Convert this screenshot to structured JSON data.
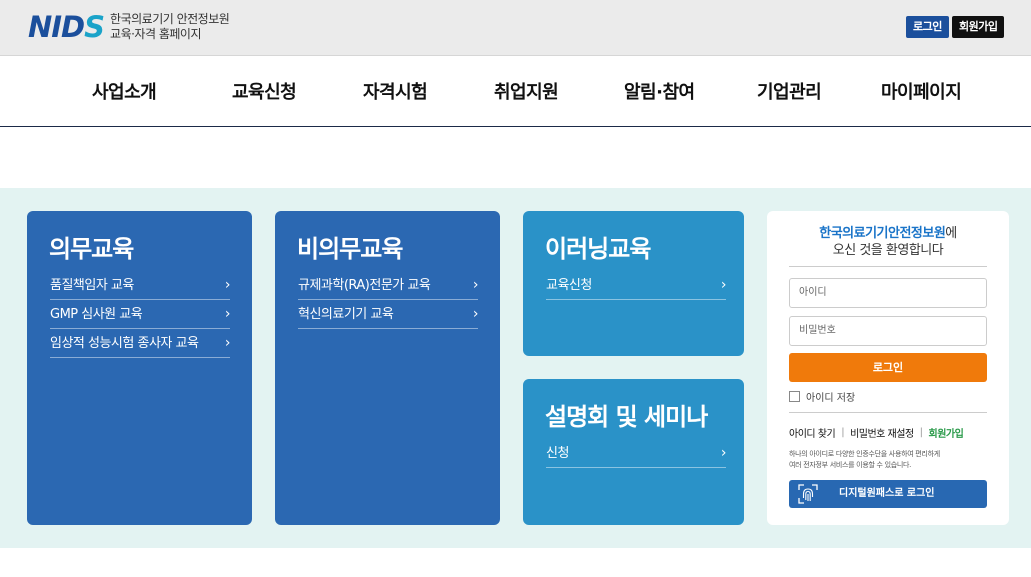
{
  "header": {
    "logo_mark_1": "NID",
    "logo_mark_2": "S",
    "logo_line1": "한국의료기기 안전정보원",
    "logo_line2": "교육·자격 홈페이지",
    "login": "로그인",
    "join": "회원가입"
  },
  "nav": [
    "사업소개",
    "교육신청",
    "자격시험",
    "취업지원",
    "알림·참여",
    "기업관리",
    "마이페이지"
  ],
  "cards": {
    "mandatory": {
      "title": "의무교육",
      "links": [
        "품질책임자 교육",
        "GMP 심사원 교육",
        "임상적 성능시험 종사자 교육"
      ]
    },
    "optional": {
      "title": "비의무교육",
      "links": [
        "규제과학(RA)전문가 교육",
        "혁신의료기기 교육"
      ]
    },
    "elearning": {
      "title": "이러닝교육",
      "links": [
        "교육신청"
      ]
    },
    "seminar": {
      "title": "설명회 및 세미나",
      "links": [
        "신청"
      ]
    },
    "chevron": "›"
  },
  "login_box": {
    "welcome_brand": "한국의료기기안전정보원",
    "welcome_suffix": "에",
    "welcome_line2": "오신 것을 환영합니다",
    "id_placeholder": "아이디",
    "pw_placeholder": "비밀번호",
    "login_button": "로그인",
    "save_id": "아이디 저장",
    "find_id": "아이디 찾기",
    "reset_pw": "비밀번호 재설정",
    "join": "회원가입",
    "sep": "|",
    "desc_line1": "하나의 아이디로 다양한 인증수단을 사용하여 편리하게",
    "desc_line2": "여러 전자정부 서비스를 이용할 수 있습니다.",
    "digital_login": "디지털원패스로 로그인"
  },
  "colors": {
    "brand_blue": "#1b4f9c",
    "card_blue": "#2b68b2",
    "card_teal": "#2a92c8",
    "band_bg": "#e3f3f2",
    "login_orange": "#f07a0b",
    "join_green": "#2a9a4a"
  }
}
